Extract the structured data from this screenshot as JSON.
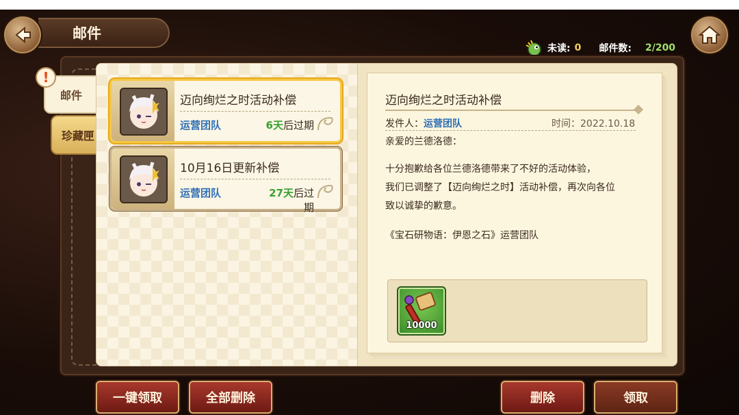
{
  "header": {
    "title": "邮件",
    "back_icon": "arrow-left-icon",
    "home_icon": "home-icon"
  },
  "status": {
    "unread_label": "未读:",
    "unread_count": "0",
    "mail_count_label": "邮件数:",
    "mail_count": "2/200"
  },
  "tabs": [
    {
      "label": "邮件"
    },
    {
      "label": "珍藏匣"
    }
  ],
  "mails": [
    {
      "title": "迈向绚烂之时活动补偿",
      "from": "运营团队",
      "days": "6天",
      "expire_suffix": "后过期"
    },
    {
      "title": "10月16日更新补偿",
      "from": "运营团队",
      "days": "27天",
      "expire_suffix": "后过期"
    }
  ],
  "detail": {
    "title": "迈向绚烂之时活动补偿",
    "sender_label": "发件人：",
    "sender": "运营团队",
    "time": "时间：2022.10.18",
    "greeting": "亲爱的兰德洛德：",
    "body_lines": [
      "十分抱歉给各位兰德洛德带来了不好的活动体验，",
      "我们已调整了【迈向绚烂之时】活动补偿，再次向各位",
      "致以诚挚的歉意。"
    ],
    "signature": "《宝石研物语：伊恩之石》运营团队",
    "attachment": {
      "count": "10000",
      "icon": "hammer-item-icon"
    }
  },
  "buttons": {
    "claim_all": "一键领取",
    "delete_all": "全部删除",
    "delete": "删除",
    "claim": "领取"
  },
  "colors": {
    "accent_gold": "#f5c842",
    "button_red": "#a8382c",
    "sender_blue": "#2f6fb5",
    "days_green": "#3aa030"
  }
}
